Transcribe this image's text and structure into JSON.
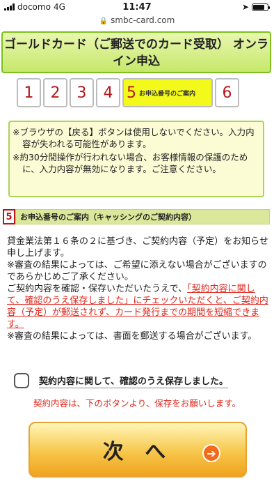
{
  "status_bar": {
    "carrier": "docomo",
    "network": "4G",
    "time": "11:47"
  },
  "browser": {
    "url": "smbc-card.com"
  },
  "title": "ゴールドカード（ご郵送でのカード受取） オンライン申込",
  "steps": [
    {
      "number": "1"
    },
    {
      "number": "2"
    },
    {
      "number": "3"
    },
    {
      "number": "4"
    },
    {
      "number": "5",
      "label": "お申込番号のご案内"
    },
    {
      "number": "6"
    }
  ],
  "notice": {
    "items": [
      "※ブラウザの【戻る】ボタンは使用しないでください。入力内容が失われる可能性があります。",
      "※約30分間操作が行われない場合、お客様情報の保護のために、入力内容が無効になります。ご注意ください。"
    ]
  },
  "section": {
    "number": "5",
    "title": "お申込番号のご案内（キャッシングのご契約内容）"
  },
  "body": {
    "p1": "貸金業法第１６条の２に基づき、ご契約内容（予定）をお知らせ申し上げます。",
    "p2": "※審査の結果によっては、ご希望に添えない場合がございますのであらかじめご了承ください。",
    "p3_prefix": "ご契約内容を確認・保存いただいたうえで、",
    "p3_red": "「契約内容に関して、確認のうえ保存しました」にチェックいただくと、ご契約内容（予定）が郵送されず、カード発行までの期間を短縮できます。",
    "p4": "※審査の結果によっては、書面を郵送する場合がございます。"
  },
  "checkbox": {
    "label": "契約内容に関して、確認のうえ保存しました。",
    "checked": false,
    "note": "契約内容は、下のボタンより、保存をお願いします。"
  },
  "next_button": {
    "label": "次 へ"
  },
  "colors": {
    "accent_green": "#7fbf1e",
    "step_red": "#b5171c",
    "notice_red": "#e1261c",
    "button_orange": "#f0a21e"
  }
}
